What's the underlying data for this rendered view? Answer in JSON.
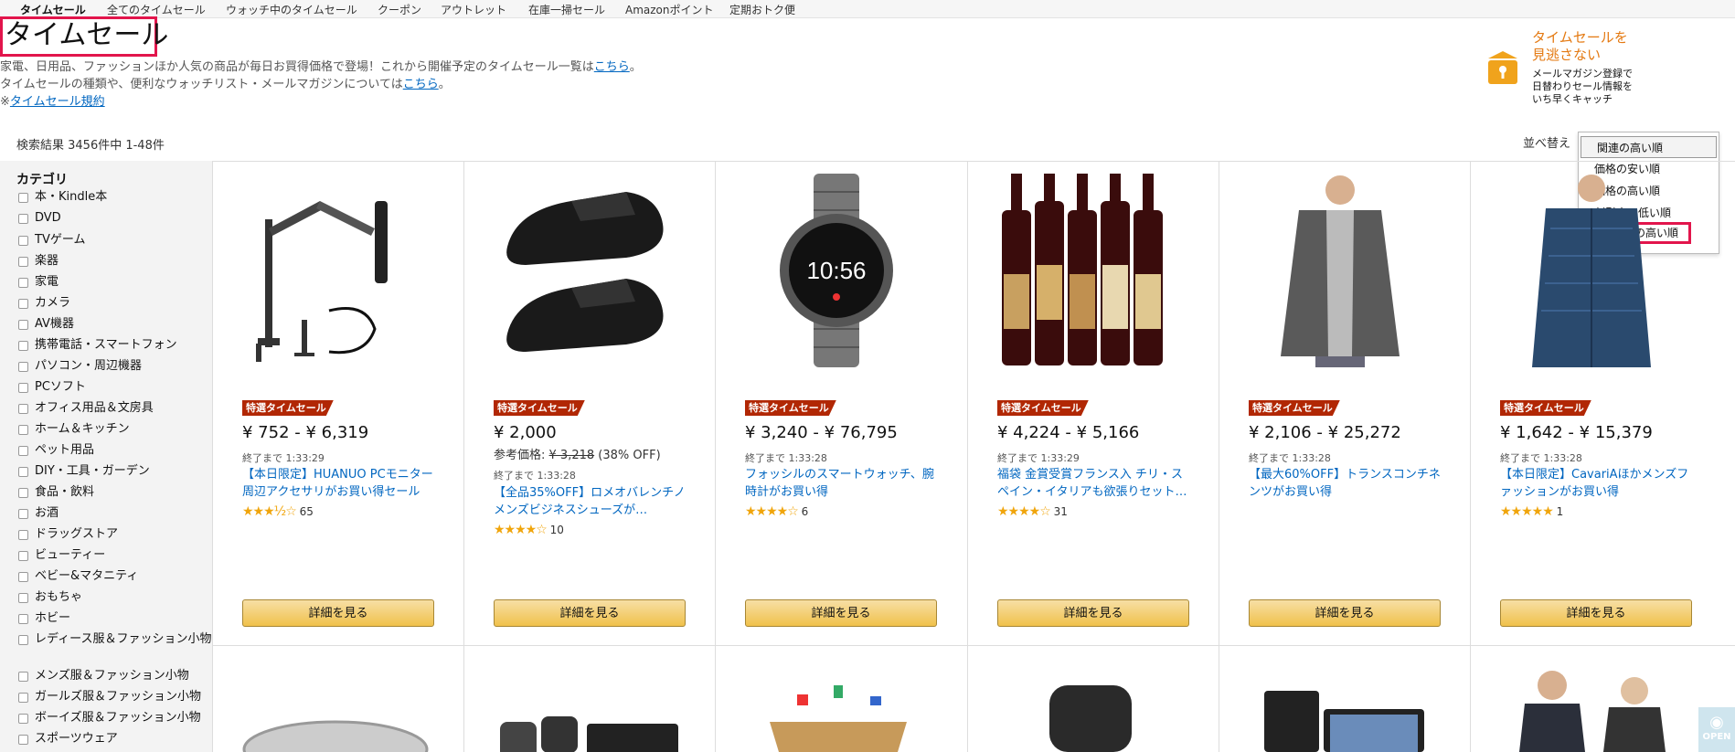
{
  "nav": {
    "items": [
      "タイムセール",
      "全てのタイムセール",
      "ウォッチ中のタイムセール",
      "クーポン",
      "アウトレット",
      "在庫一掃セール",
      "Amazonポイント",
      "定期おトク便"
    ]
  },
  "header": {
    "title": "タイムセール",
    "desc1": "家電、日用品、ファッションほか人気の商品が毎日お買得価格で登場！これから開催予定のタイムセール一覧は",
    "desc1_link": "こちら",
    "desc1_end": "。",
    "desc2": "タイムセールの種類や、便利なウォッチリスト・メールマガジンについては",
    "desc2_link": "こちら",
    "desc2_end": "。",
    "desc3_prefix": "※",
    "desc3_link": "タイムセール規約"
  },
  "promo": {
    "title_line1": "タイムセールを",
    "title_line2": "見逃さない",
    "sub_line1": "メールマガジン登録で",
    "sub_line2": "日替わりセール情報を",
    "sub_line3": "いち早くキャッチ",
    "accent_color": "#e47911"
  },
  "results": {
    "count": "検索結果 3456件中 1-48件",
    "sort_label": "並べ替え",
    "sort_options": [
      "関連の高い順",
      "価格の安い順",
      "価格の高い順",
      "割引率の低い順",
      "割引率の高い順"
    ]
  },
  "sidebar": {
    "heading": "カテゴリ",
    "categories": [
      "本・Kindle本",
      "DVD",
      "TVゲーム",
      "楽器",
      "家電",
      "カメラ",
      "AV機器",
      "携帯電話・スマートフォン",
      "パソコン・周辺機器",
      "PCソフト",
      "オフィス用品＆文房具",
      "ホーム＆キッチン",
      "ペット用品",
      "DIY・工具・ガーデン",
      "食品・飲料",
      "お酒",
      "ドラッグストア",
      "ビューティー",
      "ベビー&マタニティ",
      "おもちゃ",
      "ホビー",
      "レディース服＆ファッション小物",
      "メンズ服＆ファッション小物",
      "ガールズ服＆ファッション小物",
      "ボーイズ服＆ファッション小物",
      "スポーツウェア"
    ]
  },
  "products": [
    {
      "badge": "特選タイムセール",
      "price": "¥ 752 - ¥ 6,319",
      "timer": "終了まで 1:33:29",
      "title": "【本日限定】HUANUO PCモニター周辺アクセサリがお買い得セール",
      "stars": "★★★½☆",
      "reviews": "65",
      "button": "詳細を見る",
      "image": "monitor-arm-image"
    },
    {
      "badge": "特選タイムセール",
      "price": "¥ 2,000",
      "list_price_label": "参考価格:",
      "list_price": "¥ 3,218",
      "discount": "(38% OFF)",
      "timer": "終了まで 1:33:28",
      "title": "【全品35%OFF】ロメオバレンチノ メンズビジネスシューズが…",
      "stars": "★★★★☆",
      "reviews": "10",
      "button": "詳細を見る",
      "image": "shoes-image"
    },
    {
      "badge": "特選タイムセール",
      "price": "¥ 3,240 - ¥ 76,795",
      "timer": "終了まで 1:33:28",
      "title": "フォッシルのスマートウォッチ、腕時計がお買い得",
      "stars": "★★★★☆",
      "reviews": "6",
      "button": "詳細を見る",
      "image": "smartwatch-image",
      "watch_time": "10:56"
    },
    {
      "badge": "特選タイムセール",
      "price": "¥ 4,224 - ¥ 5,166",
      "timer": "終了まで 1:33:29",
      "title": "福袋 金賞受賞フランス入 チリ・スペイン・イタリアも欲張りセット…",
      "stars": "★★★★☆",
      "reviews": "31",
      "button": "詳細を見る",
      "image": "wine-bottles-image"
    },
    {
      "badge": "特選タイムセール",
      "price": "¥ 2,106 - ¥ 25,272",
      "timer": "終了まで 1:33:28",
      "title": "【最大60%OFF】トランスコンチネンツがお買い得",
      "stars": "",
      "reviews": "",
      "button": "詳細を見る",
      "image": "jacket-image"
    },
    {
      "badge": "特選タイムセール",
      "price": "¥ 1,642 - ¥ 15,379",
      "timer": "終了まで 1:33:28",
      "title": "【本日限定】CavariAほかメンズファッションがお買い得",
      "stars": "★★★★★",
      "reviews": "1",
      "button": "詳細を見る",
      "image": "denim-shirt-image"
    }
  ],
  "open_badge": "OPEN"
}
